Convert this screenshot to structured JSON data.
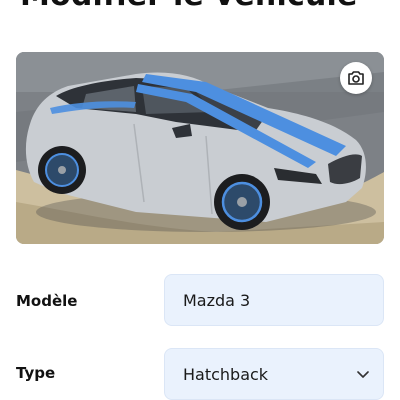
{
  "header": {
    "title": "Modifier le véhicule"
  },
  "photo": {
    "camera_icon": "camera-icon",
    "colors": {
      "car_body": "#c9cdd2",
      "stripe": "#4d8fe0",
      "ground": "#cfc3a8",
      "road": "#7f8387"
    }
  },
  "form": {
    "model": {
      "label": "Modèle",
      "value": "Mazda 3"
    },
    "type": {
      "label": "Type",
      "value": "Hatchback",
      "icon": "chevron-down-icon"
    }
  },
  "colors": {
    "field_bg": "#eaf2fd",
    "text": "#111111"
  }
}
